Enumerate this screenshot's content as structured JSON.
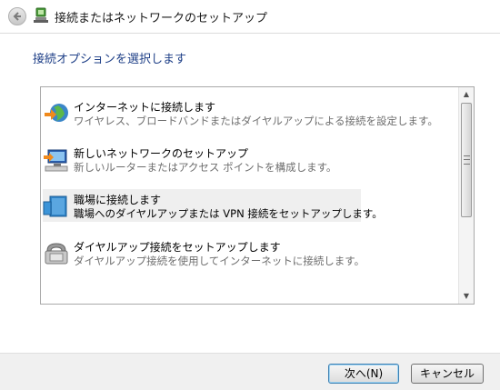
{
  "window": {
    "title": "接続またはネットワークのセットアップ"
  },
  "instruction": "接続オプションを選択します",
  "options": [
    {
      "title": "インターネットに接続します",
      "description": "ワイヤレス、ブロードバンドまたはダイヤルアップによる接続を設定します。",
      "icon": "globe-connect-icon",
      "selected": false
    },
    {
      "title": "新しいネットワークのセットアップ",
      "description": "新しいルーターまたはアクセス ポイントを構成します。",
      "icon": "new-network-icon",
      "selected": false
    },
    {
      "title": "職場に接続します",
      "description": "職場へのダイヤルアップまたは VPN 接続をセットアップします。",
      "icon": "workplace-connect-icon",
      "selected": true
    },
    {
      "title": "ダイヤルアップ接続をセットアップします",
      "description": "ダイヤルアップ接続を使用してインターネットに接続します。",
      "icon": "telephone-icon",
      "selected": false
    }
  ],
  "buttons": {
    "next": "次へ(N)",
    "cancel": "キャンセル"
  },
  "colors": {
    "instruction": "#1e3f87",
    "selected_row": "#efefef",
    "description": "#6d6d6d"
  }
}
